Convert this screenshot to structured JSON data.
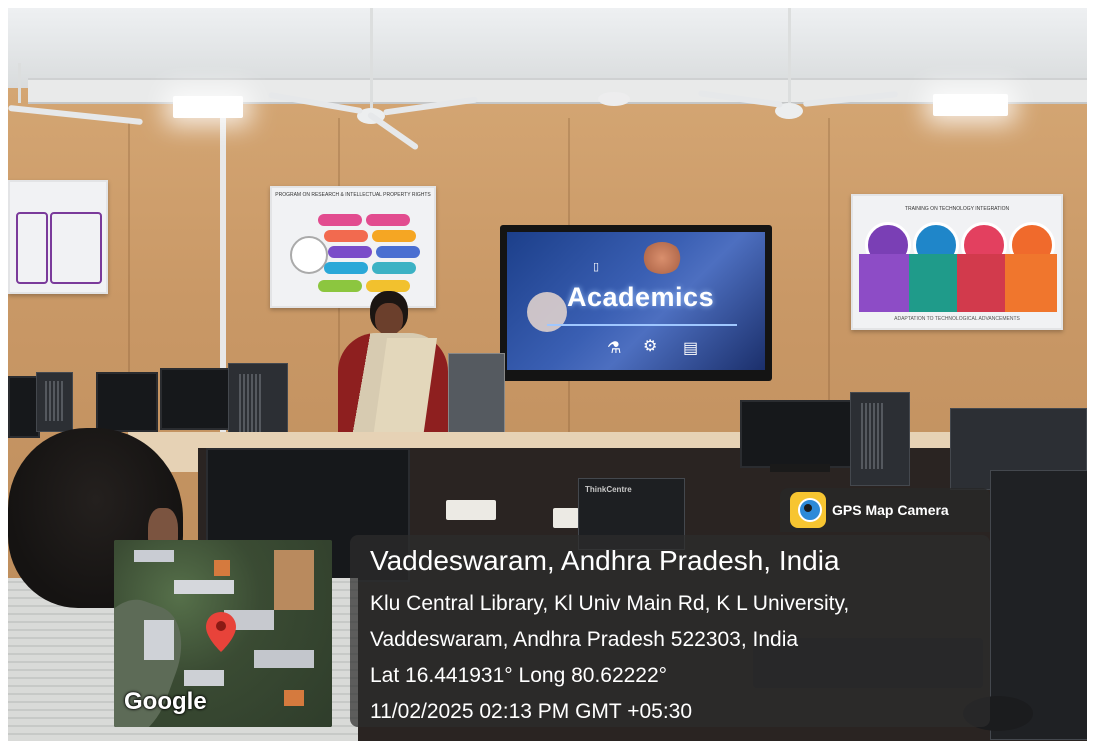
{
  "scene": {
    "tv_screen_text": "Academics",
    "poster_left_title": "PROGRAM ON RESEARCH & INTELLECTUAL PROPERTY RIGHTS",
    "poster_right_title": "TRAINING ON TECHNOLOGY INTEGRATION",
    "poster_right_footer": "ADAPTATION TO TECHNOLOGICAL ADVANCEMENTS",
    "pc_brand": "ThinkCentre"
  },
  "gps_stamp": {
    "app_name": "GPS Map Camera",
    "location_title": "Vaddeswaram, Andhra Pradesh, India",
    "address_line_1": "Klu Central Library, Kl Univ Main Rd, K L University,",
    "address_line_2": "Vaddeswaram, Andhra Pradesh 522303, India",
    "coordinates": "Lat 16.441931° Long 80.62222°",
    "datetime": "11/02/2025 02:13 PM GMT +05:30",
    "map_logo": "Google"
  },
  "icons": [
    "gps-camera-app-icon",
    "map-pin-icon"
  ],
  "colors": {
    "overlay": "#2d2d2d",
    "pin": "#e8433a",
    "app_icon": "#f7c531"
  }
}
